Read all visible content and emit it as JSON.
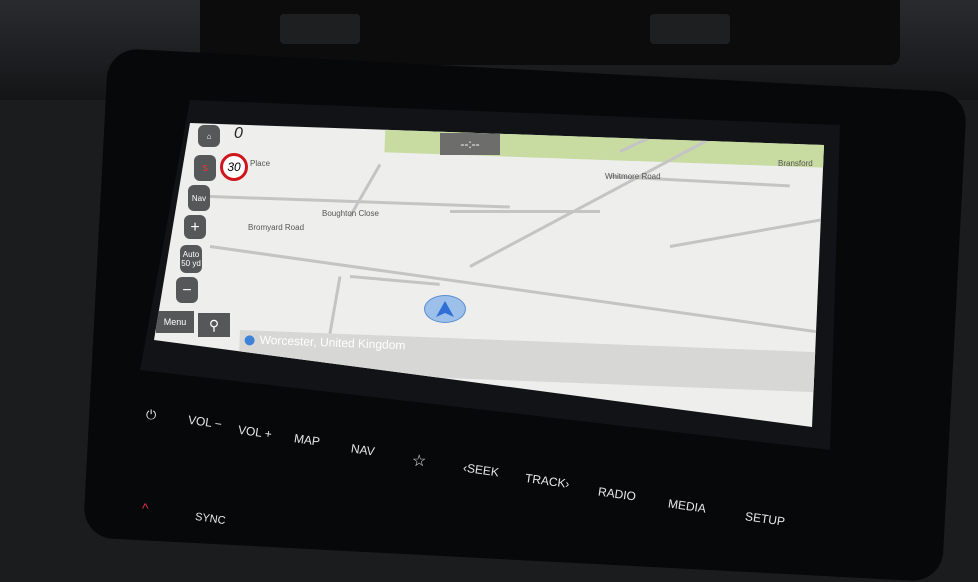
{
  "map": {
    "top_left_value": "0",
    "speed_limit": "30",
    "eta_display": "--:--",
    "streets": [
      "Place",
      "Whitmore Road",
      "Bransford",
      "Boughton Close",
      "Bromyard Road"
    ],
    "location": "Worcester, United Kingdom"
  },
  "map_controls": {
    "home_icon": "home-icon",
    "compass_label": "S",
    "nav_label": "Nav",
    "zoom_in": "+",
    "auto_label": "Auto",
    "scale_label": "50 yd",
    "zoom_out": "−",
    "menu_label": "Menu",
    "search_icon": "search-icon"
  },
  "hardware_buttons": [
    "VOL −",
    "VOL +",
    "MAP",
    "NAV",
    "☆",
    "‹SEEK",
    "TRACK›",
    "RADIO",
    "MEDIA",
    "SETUP",
    "SYNC"
  ],
  "colors": {
    "speed_ring": "#d0151c",
    "park": "#c8dca2",
    "arrow": "#2f6fd6"
  }
}
